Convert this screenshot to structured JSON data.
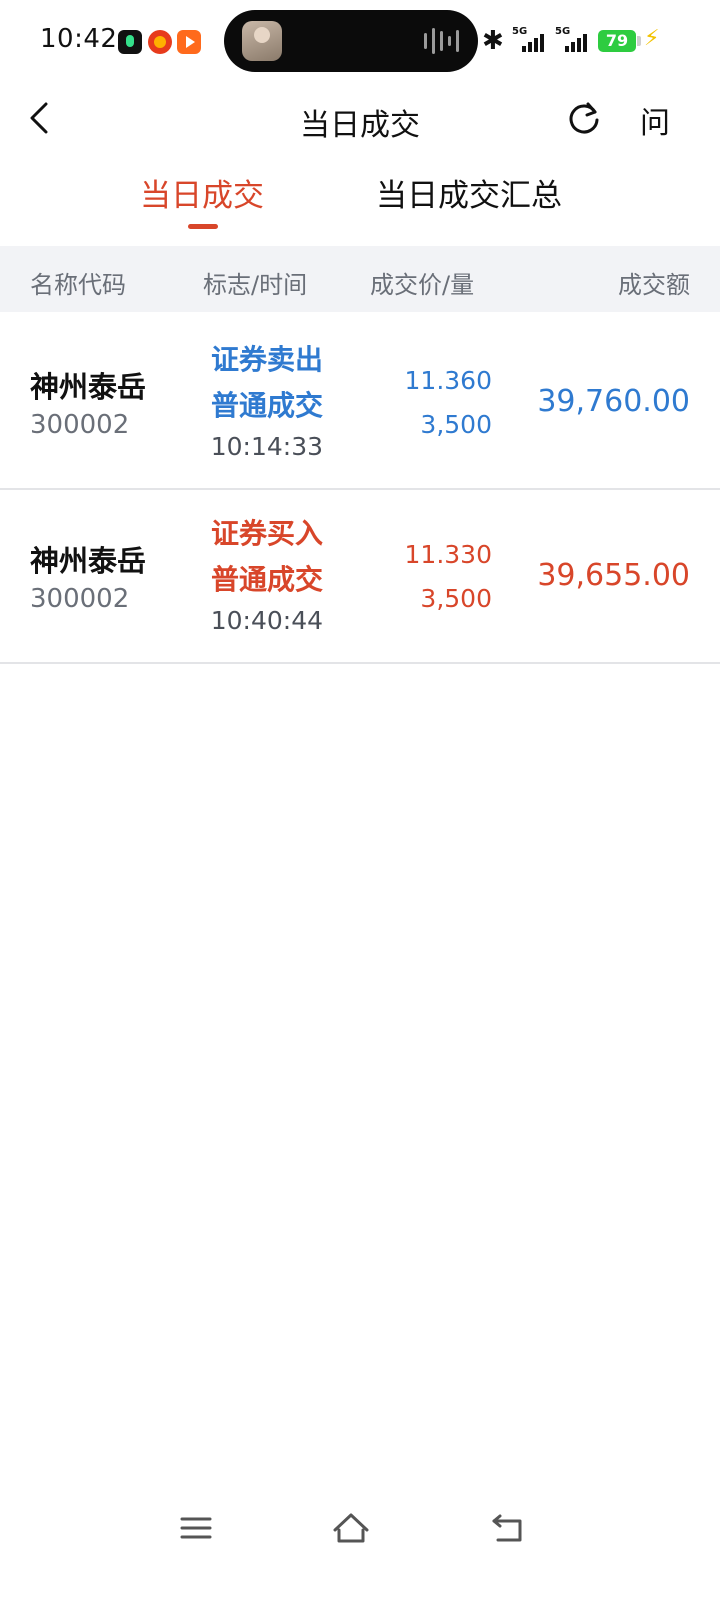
{
  "status_bar": {
    "time": "10:42",
    "battery": "79",
    "signal_labels": [
      "5G",
      "5G"
    ]
  },
  "header": {
    "title": "当日成交",
    "help_label": "问"
  },
  "tabs": [
    {
      "label": "当日成交",
      "active": true
    },
    {
      "label": "当日成交汇总",
      "active": false
    }
  ],
  "columns": {
    "name_code": "名称代码",
    "flag_time": "标志/时间",
    "price_qty": "成交价/量",
    "amount": "成交额"
  },
  "trades": [
    {
      "name": "神州泰岳",
      "code": "300002",
      "flag": "证券卖出",
      "type": "普通成交",
      "time": "10:14:33",
      "price": "11.360",
      "quantity": "3,500",
      "amount": "39,760.00",
      "color": "#2f7ad0"
    },
    {
      "name": "神州泰岳",
      "code": "300002",
      "flag": "证券买入",
      "type": "普通成交",
      "time": "10:40:44",
      "price": "11.330",
      "quantity": "3,500",
      "amount": "39,655.00",
      "color": "#d8462a"
    }
  ],
  "colors": {
    "accent": "#d8462a",
    "sell": "#2f7ad0",
    "buy": "#d8462a",
    "header_bg": "#f2f3f6"
  }
}
